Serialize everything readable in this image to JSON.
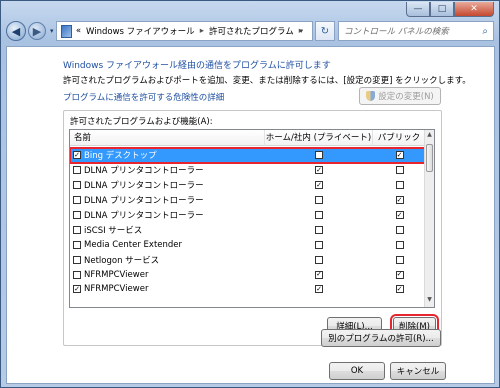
{
  "window": {
    "caption_min": "—",
    "caption_max": "□",
    "caption_close": "✕"
  },
  "nav": {
    "back": "◀",
    "forward": "▶",
    "dropdown": "▾",
    "refresh": "↻"
  },
  "address": {
    "prefix": "«",
    "crumbs": [
      "Windows ファイアウォール",
      "許可されたプログラム"
    ],
    "separator": "▸"
  },
  "search": {
    "placeholder": "コントロール パネルの検索",
    "icon": "search-icon"
  },
  "page": {
    "heading": "Windows ファイアウォール経由の通信をプログラムに許可します",
    "description": "許可されたプログラムおよびポートを追加、変更、または削除するには、[設定の変更] をクリックします。",
    "risk_link": "プログラムに通信を許可する危険性の詳細",
    "change_settings": "設定の変更(N)"
  },
  "list": {
    "group_label": "許可されたプログラムおよび機能(A):",
    "columns": [
      "名前",
      "ホーム/社内 (プライベート)",
      "パブリック"
    ],
    "rows": [
      {
        "name": "Bing デスクトップ",
        "enabled": true,
        "home": false,
        "public": true,
        "selected": true
      },
      {
        "name": "DLNA プリンタコントローラー",
        "enabled": false,
        "home": true,
        "public": false
      },
      {
        "name": "DLNA プリンタコントローラー",
        "enabled": false,
        "home": true,
        "public": false
      },
      {
        "name": "DLNA プリンタコントローラー",
        "enabled": false,
        "home": false,
        "public": true
      },
      {
        "name": "DLNA プリンタコントローラー",
        "enabled": false,
        "home": false,
        "public": true
      },
      {
        "name": "iSCSI サービス",
        "enabled": false,
        "home": false,
        "public": false
      },
      {
        "name": "Media Center Extender",
        "enabled": false,
        "home": false,
        "public": false
      },
      {
        "name": "Netlogon サービス",
        "enabled": false,
        "home": false,
        "public": false
      },
      {
        "name": "NFRMPCViewer",
        "enabled": false,
        "home": true,
        "public": true
      },
      {
        "name": "NFRMPCViewer",
        "enabled": true,
        "home": true,
        "public": true
      }
    ]
  },
  "buttons": {
    "details": "詳細(L)...",
    "remove": "削除(M)",
    "allow_other": "別のプログラムの許可(R)...",
    "ok": "OK",
    "cancel": "キャンセル"
  },
  "colors": {
    "selection": "#3399ff",
    "annotation_red": "#e8242e",
    "link_blue": "#1f4fa0"
  }
}
